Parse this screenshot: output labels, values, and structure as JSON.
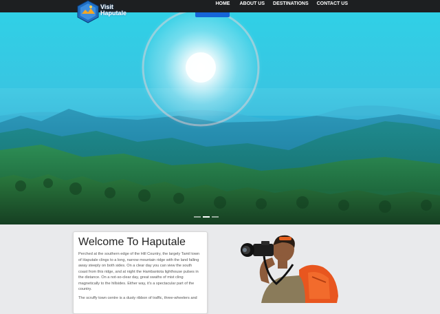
{
  "nav": {
    "items": [
      {
        "label": "HOME"
      },
      {
        "label": "ABOUT US"
      },
      {
        "label": "DESTINATIONS"
      },
      {
        "label": "CONTACT US"
      }
    ]
  },
  "logo": {
    "line1": "Visit",
    "line2": "Haputale"
  },
  "hero": {
    "slide_count": 3,
    "active_slide": 1
  },
  "content": {
    "title": "Welcome To Haputale",
    "paragraph1": "Perched at the southern edge of the Hill Country, the largely Tamil town of Haputale clings to a long, narrow mountain ridge with the land falling away steeply on both sides. On a clear day you can view the south coast from this ridge, and at night the Hambantota lighthouse pulses in the distance. On a not-so-clear day, great swaths of mist cling magnetically to the hillsides. Either way, it's a spectacular part of the country.",
    "paragraph2": "The scruffy town centre is a dusty ribbon of traffic, three-wheelers and"
  },
  "colors": {
    "navbar": "#1d1f21",
    "accent": "#1565d8"
  }
}
